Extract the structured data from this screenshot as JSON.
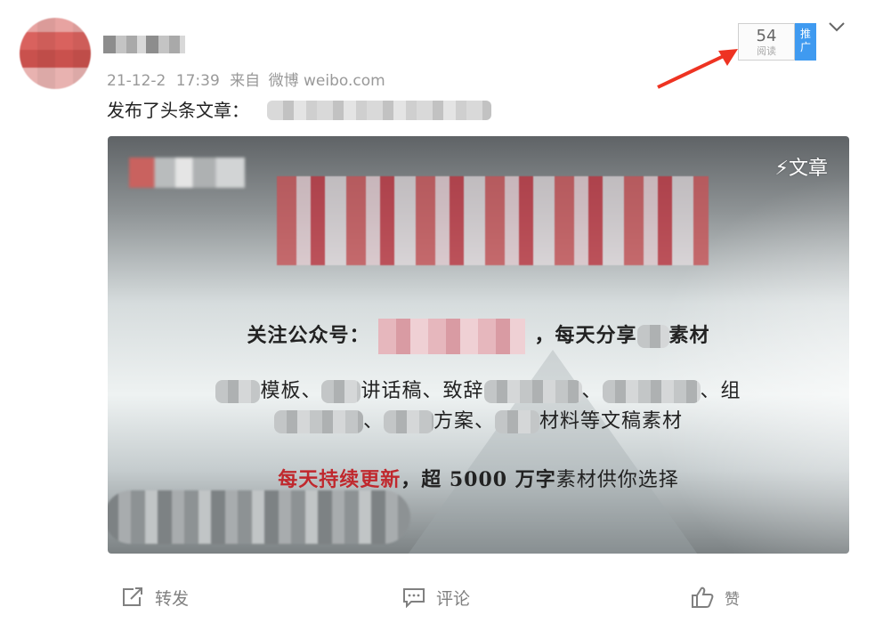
{
  "post": {
    "timestamp": "21-12-2",
    "time": "17:39",
    "source_prefix": "来自",
    "source": "微博 weibo.com",
    "text": "发布了头条文章："
  },
  "stats": {
    "read_count": "54",
    "read_label": "阅读",
    "promote_label": "推广"
  },
  "article_card": {
    "tag": "⚡文章",
    "line1_prefix": "关注公众号：",
    "line1_suffix": "，每天分享",
    "line1_end": "素材",
    "line2_a": "模板、",
    "line2_b": "讲话稿、致辞",
    "line2_c": "、",
    "line2_d": "、组",
    "line3_a": "、",
    "line3_b": "方案、",
    "line3_c": "材料等文稿素材",
    "line4_red": "每天持续更新",
    "line4_rest": "，超 5000 万字",
    "line4_end": "素材供你选择"
  },
  "actions": {
    "repost": "转发",
    "comment": "评论",
    "like": "赞"
  },
  "colors": {
    "promote_bg": "#3f9af0",
    "annotation_arrow": "#ee3322",
    "highlight_red": "#c0282d"
  }
}
